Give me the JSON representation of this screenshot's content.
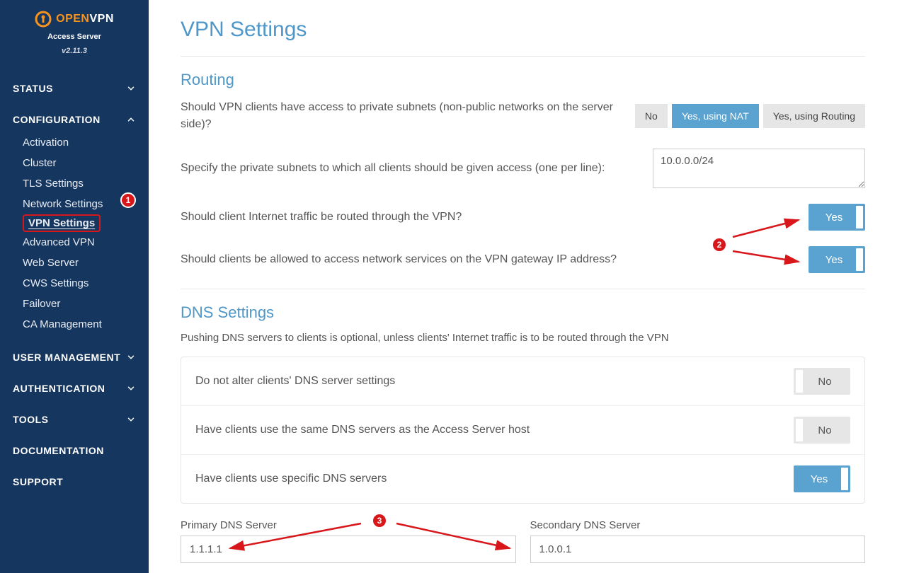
{
  "brand": {
    "open": "OPEN",
    "vpn": "VPN",
    "sub": "Access Server",
    "version": "v2.11.3"
  },
  "nav": {
    "status": "STATUS",
    "configuration": "CONFIGURATION",
    "config_items": [
      "Activation",
      "Cluster",
      "TLS Settings",
      "Network Settings",
      "VPN Settings",
      "Advanced VPN",
      "Web Server",
      "CWS Settings",
      "Failover",
      "CA Management"
    ],
    "user_mgmt": "USER MANAGEMENT",
    "auth": "AUTHENTICATION",
    "tools": "TOOLS",
    "docs": "DOCUMENTATION",
    "support": "SUPPORT"
  },
  "page": {
    "title": "VPN Settings",
    "routing": {
      "heading": "Routing",
      "q_subnets": "Should VPN clients have access to private subnets (non-public networks on the server side)?",
      "opts": {
        "no": "No",
        "nat": "Yes, using NAT",
        "routing": "Yes, using Routing"
      },
      "q_specify": "Specify the private subnets to which all clients should be given access (one per line):",
      "subnets_value": "10.0.0.0/24",
      "q_route_all": "Should client Internet traffic be routed through the VPN?",
      "q_gateway": "Should clients be allowed to access network services on the VPN gateway IP address?"
    },
    "dns": {
      "heading": "DNS Settings",
      "desc": "Pushing DNS servers to clients is optional, unless clients' Internet traffic is to be routed through the VPN",
      "opt_noalter": "Do not alter clients' DNS server settings",
      "opt_same": "Have clients use the same DNS servers as the Access Server host",
      "opt_specific": "Have clients use specific DNS servers",
      "primary_label": "Primary DNS Server",
      "primary_value": "1.1.1.1",
      "secondary_label": "Secondary DNS Server",
      "secondary_value": "1.0.0.1"
    },
    "toggle": {
      "yes": "Yes",
      "no": "No"
    },
    "annotations": {
      "n1": "1",
      "n2": "2",
      "n3": "3"
    }
  }
}
